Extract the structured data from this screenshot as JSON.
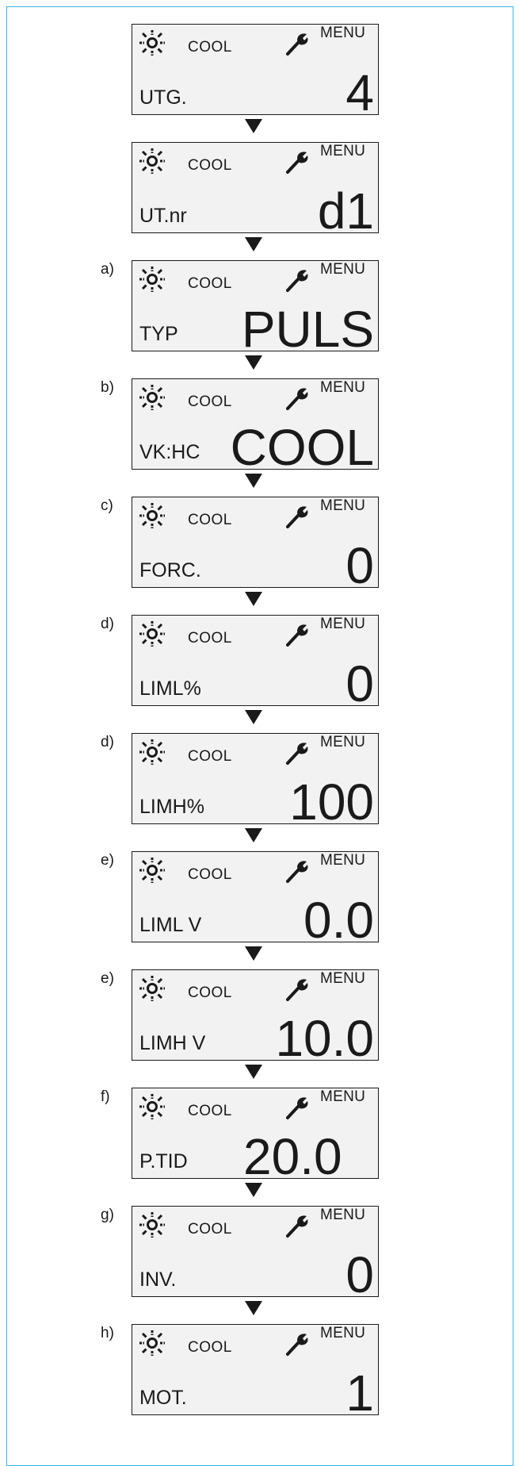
{
  "screens": [
    {
      "step": "",
      "mode": "COOL",
      "menu": "MENU",
      "label": "UTG.",
      "value": "4",
      "align": "right"
    },
    {
      "step": "",
      "mode": "COOL",
      "menu": "MENU",
      "label": "UT.nr",
      "value": "d1",
      "align": "right"
    },
    {
      "step": "a)",
      "mode": "COOL",
      "menu": "MENU",
      "label": "TYP",
      "value": "PULS",
      "align": "right"
    },
    {
      "step": "b)",
      "mode": "COOL",
      "menu": "MENU",
      "label": "VK:HC",
      "value": "COOL",
      "align": "right"
    },
    {
      "step": "c)",
      "mode": "COOL",
      "menu": "MENU",
      "label": "FORC.",
      "value": "0",
      "align": "right"
    },
    {
      "step": "d)",
      "mode": "COOL",
      "menu": "MENU",
      "label": "LIML%",
      "value": "0",
      "align": "right"
    },
    {
      "step": "d)",
      "mode": "COOL",
      "menu": "MENU",
      "label": "LIMH%",
      "value": "100",
      "align": "right"
    },
    {
      "step": "e)",
      "mode": "COOL",
      "menu": "MENU",
      "label": "LIML V",
      "value": "0.0",
      "align": "right"
    },
    {
      "step": "e)",
      "mode": "COOL",
      "menu": "MENU",
      "label": "LIMH V",
      "value": "10.0",
      "align": "right"
    },
    {
      "step": "f)",
      "mode": "COOL",
      "menu": "MENU",
      "label": "P.TID",
      "value": "20.0",
      "align": "mid"
    },
    {
      "step": "g)",
      "mode": "COOL",
      "menu": "MENU",
      "label": "INV.",
      "value": "0",
      "align": "right"
    },
    {
      "step": "h)",
      "mode": "COOL",
      "menu": "MENU",
      "label": "MOT.",
      "value": "1",
      "align": "right"
    }
  ],
  "colors": {
    "border": "#3db1e8",
    "screen_bg": "#f2f2f2",
    "ink": "#1a1a1a"
  },
  "icons": {
    "status": "sun-icon",
    "settings": "wrench-icon",
    "flow": "arrow-down-icon"
  }
}
